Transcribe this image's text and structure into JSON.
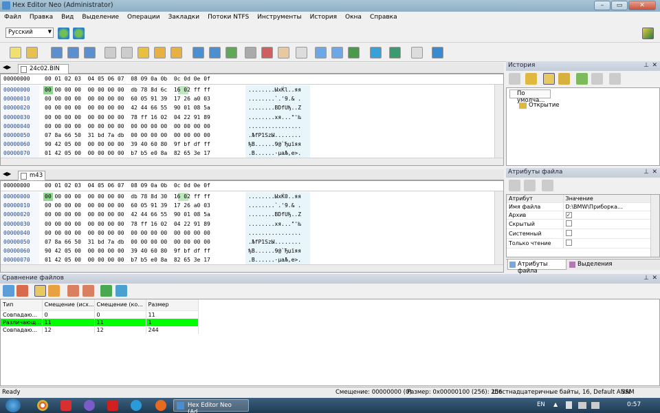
{
  "window": {
    "title": "Hex Editor Neo (Administrator)"
  },
  "menu": [
    "Файл",
    "Правка",
    "Вид",
    "Выделение",
    "Операции",
    "Закладки",
    "Потоки NTFS",
    "Инструменты",
    "История",
    "Окна",
    "Справка"
  ],
  "toolbar": {
    "language": "Русский"
  },
  "hex_header": {
    "offset": "00000000",
    "cols": "00 01 02 03  04 05 06 07  08 09 0a 0b  0c 0d 0e 0f"
  },
  "editor1": {
    "tab": "24c02.BIN",
    "rows": [
      {
        "off": "00000000",
        "hex": "00 00 00 00  00 00 00 00  db 78 8d 6c  16 02 ff ff",
        "ascii": "........ЫхЌl..яя"
      },
      {
        "off": "00000010",
        "hex": "00 00 00 00  00 00 00 00  60 05 91 39  17 26 a0 03",
        "ascii": "........`.'9.& ."
      },
      {
        "off": "00000020",
        "hex": "00 00 00 00  00 00 00 00  42 44 66 55  90 01 08 5a",
        "ascii": "........BDfUђ..Z"
      },
      {
        "off": "00000030",
        "hex": "00 00 00 00  00 00 00 00  78 ff 16 02  04 22 91 89",
        "ascii": "........xя...\"'‰"
      },
      {
        "off": "00000040",
        "hex": "00 00 00 00  00 00 00 00  00 00 00 00  00 00 00 00",
        "ascii": "................"
      },
      {
        "off": "00000050",
        "hex": "07 8a 66 50  31 bd 7a db  00 00 00 00  00 00 00 00",
        "ascii": ".ЉfP1ЅzЫ........"
      },
      {
        "off": "00000060",
        "hex": "90 42 05 00  00 00 00 00  39 40 60 80  9f bf df ff",
        "ascii": "ђB......9@`Ђџїяя"
      },
      {
        "off": "00000070",
        "hex": "01 42 05 00  00 00 00 00  b7 b5 e0 8a  82 65 3e 17",
        "ascii": ".B......·µаЉ‚e>."
      }
    ]
  },
  "editor2": {
    "tab": "m43",
    "rows": [
      {
        "off": "00000000",
        "hex": "00 00 00 00  00 00 00 00  db 78 8d 30  16 02 ff ff",
        "ascii": "........ЫхЌ0..яя"
      },
      {
        "off": "00000010",
        "hex": "00 00 00 00  00 00 00 00  60 05 91 39  17 26 a0 03",
        "ascii": "........`.'9.& ."
      },
      {
        "off": "00000020",
        "hex": "00 00 00 00  00 00 00 00  42 44 66 55  90 01 08 5a",
        "ascii": "........BDfUђ..Z"
      },
      {
        "off": "00000030",
        "hex": "00 00 00 00  00 00 00 00  78 ff 16 02  04 22 91 89",
        "ascii": "........xя...\"'‰"
      },
      {
        "off": "00000040",
        "hex": "00 00 00 00  00 00 00 00  00 00 00 00  00 00 00 00",
        "ascii": "................"
      },
      {
        "off": "00000050",
        "hex": "07 8a 66 50  31 bd 7a db  00 00 00 00  00 00 00 00",
        "ascii": ".ЉfP1ЅzЫ........"
      },
      {
        "off": "00000060",
        "hex": "90 42 05 00  00 00 00 00  39 40 60 80  9f bf df ff",
        "ascii": "ђB......9@`Ђџїяя"
      },
      {
        "off": "00000070",
        "hex": "01 42 05 00  00 00 00 00  b7 b5 e0 8a  82 65 3e 17",
        "ascii": ".B......·µаЉ‚e>."
      }
    ]
  },
  "history": {
    "title": "История",
    "root": "По умолча...",
    "child": "Открытие"
  },
  "attributes": {
    "title": "Атрибуты файла",
    "col_attr": "Атрибут",
    "col_value": "Значение",
    "rows": [
      {
        "name": "Имя файла",
        "value": "D:\\BMW\\Приборка..."
      },
      {
        "name": "Архив",
        "checked": true
      },
      {
        "name": "Скрытый",
        "checked": false
      },
      {
        "name": "Системный",
        "checked": false
      },
      {
        "name": "Только чтение",
        "checked": false
      }
    ],
    "tab_attrs": "Атрибуты файла",
    "tab_sel": "Выделения"
  },
  "compare": {
    "title": "Сравнение файлов",
    "headers": [
      "Тип",
      "Смещение (исх...",
      "Смещение (ко...",
      "Размер"
    ],
    "rows": [
      {
        "type": "Совпадаю...",
        "off1": "0",
        "off2": "0",
        "size": "11",
        "diff": false
      },
      {
        "type": "Различающ...",
        "off1": "11",
        "off2": "11",
        "size": "1",
        "diff": true
      },
      {
        "type": "Совпадаю...",
        "off1": "12",
        "off2": "12",
        "size": "244",
        "diff": false
      }
    ],
    "diff_color": "#00ff00"
  },
  "status": {
    "ready": "Ready",
    "offset": "Смещение: 00000000 (0)",
    "size": "Размер: 0x00000100 (256): 256",
    "mode": "Шестнадцатеричные байты, 16, Default ANSI",
    "zam": "ЗАМ"
  },
  "taskbar": {
    "active": "Hex Editor Neo (Ad...",
    "lang": "EN",
    "time": "0:57"
  }
}
